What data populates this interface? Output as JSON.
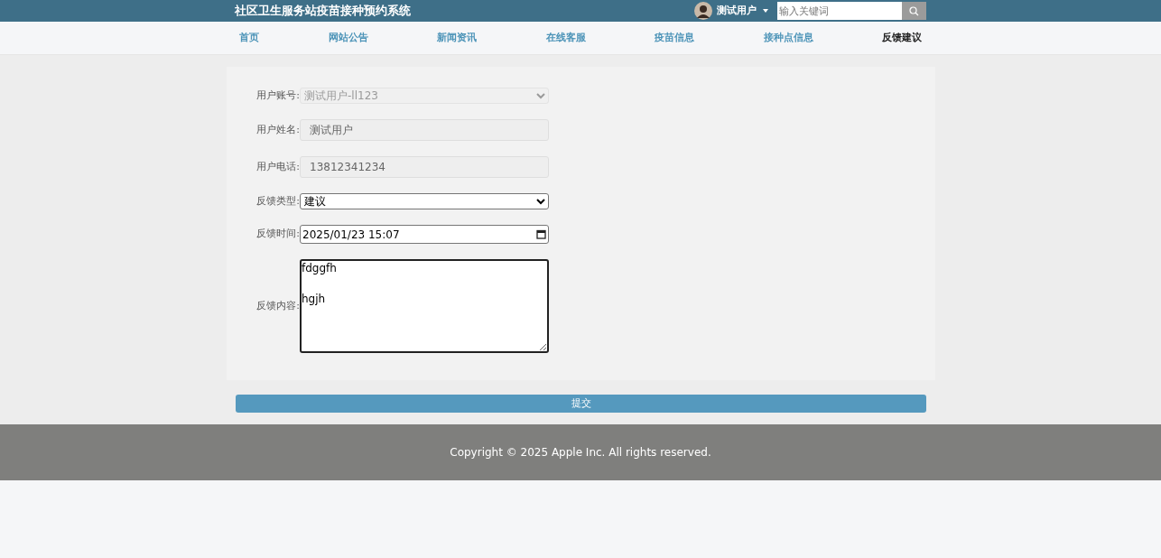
{
  "header": {
    "title": "社区卫生服务站疫苗接种预约系统",
    "user": "测试用户",
    "search": {
      "placeholder": "输入关键词"
    }
  },
  "nav": [
    {
      "label": "首页",
      "selected": false
    },
    {
      "label": "网站公告",
      "selected": false
    },
    {
      "label": "新闻资讯",
      "selected": false
    },
    {
      "label": "在线客服",
      "selected": false
    },
    {
      "label": "疫苗信息",
      "selected": false
    },
    {
      "label": "接种点信息",
      "selected": false
    },
    {
      "label": "反馈建议",
      "selected": true
    }
  ],
  "form": {
    "fields": [
      {
        "kind": "select",
        "label": "用户账号:",
        "value": "测试用户-ll123",
        "disabled": true
      },
      {
        "kind": "text",
        "label": "用户姓名:",
        "value": "测试用户",
        "disabled": true
      },
      {
        "kind": "text",
        "label": "用户电话:",
        "value": "13812341234",
        "disabled": true
      },
      {
        "kind": "select",
        "label": "反馈类型:",
        "value": "建议",
        "disabled": false
      },
      {
        "kind": "datetime",
        "label": "反馈时间:",
        "value": "2025/01/23 15:07",
        "disabled": false
      },
      {
        "kind": "textarea",
        "label": "反馈内容:",
        "value": "fdggfh\n\nhgjh",
        "disabled": false
      }
    ],
    "submit": "提交"
  },
  "footer": "Copyright © 2025 Apple Inc. All rights reserved."
}
